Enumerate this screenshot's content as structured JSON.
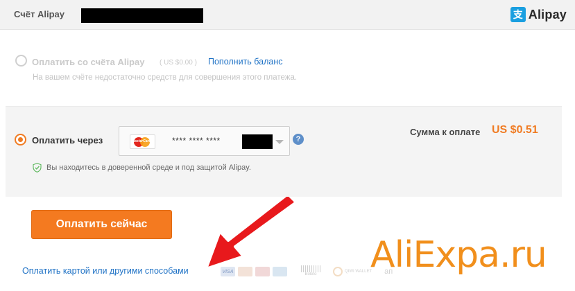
{
  "header": {
    "account_label": "Счёт Alipay",
    "brand_glyph": "支",
    "brand_name": "Alipay",
    "brand_color": "#1a9fe0"
  },
  "balance_option": {
    "title": "Оплатить со счёта Alipay",
    "balance": "( US $0.00 )",
    "topup_link": "Пополнить баланс",
    "note": "На вашем счёте недостаточно средств для совершения этого платежа.",
    "selected": false,
    "disabled": true
  },
  "card_option": {
    "title": "Оплатить через",
    "selected": true,
    "card_brand_icon": "mastercard-icon",
    "card_brand_text": "MasterCard",
    "card_number": "**** **** ****",
    "help_icon": "?",
    "secure_note": "Вы находитесь в доверенной среде и под защитой Alipay."
  },
  "summary": {
    "label": "Сумма к оплате",
    "amount": "US $0.51"
  },
  "pay_button": {
    "label": "Оплатить сейчас",
    "color": "#f47a20"
  },
  "other_methods": {
    "link": "Оплатить картой или другими способами",
    "icons": [
      "visa-icon",
      "mastercard-icon",
      "maestro-icon",
      "amex-icon",
      "boleto-icon",
      "qiwi-icon"
    ],
    "visa_text": "VISA",
    "boleto_text": "Boleto",
    "qiwi_text": "QIWI WALLET",
    "tail_text": "ап"
  },
  "watermark": {
    "text": "AliExpa.ru",
    "color": "#f18f1c"
  },
  "accent_color": "#f07b22",
  "link_color": "#1f72c5"
}
